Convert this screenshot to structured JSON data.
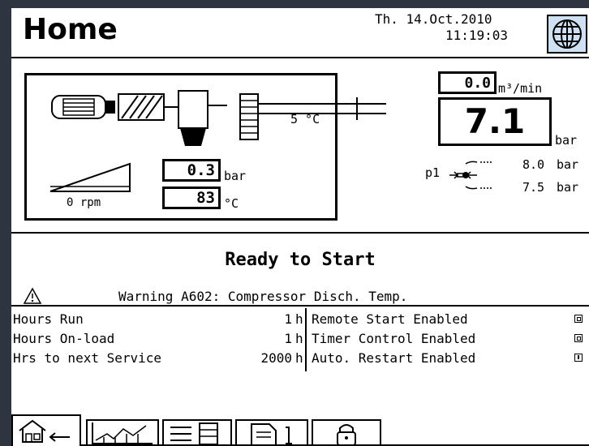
{
  "header": {
    "title": "Home",
    "date": "Th. 14.Oct.2010",
    "time": "11:19:03",
    "globe_icon": "globe-icon"
  },
  "machine": {
    "temp_label": "5 °C",
    "rpm_label": "0 rpm",
    "pressure_value": "0.3",
    "pressure_unit": "bar",
    "temp_value": "83",
    "temp_unit": "°C"
  },
  "flow": {
    "value": "0.0",
    "unit": "m³/min"
  },
  "pressure": {
    "value": "7.1",
    "unit": "bar",
    "p1_label": "p1",
    "upper_value": "8.0",
    "upper_unit": "bar",
    "lower_value": "7.5",
    "lower_unit": "bar"
  },
  "status": {
    "text": "Ready to Start",
    "warning_icon": "warning-triangle-icon",
    "warning_text": "Warning A602: Compressor Disch. Temp."
  },
  "counters": [
    {
      "label": "Hours Run",
      "value": "1",
      "unit": "h"
    },
    {
      "label": "Hours On-load",
      "value": "1",
      "unit": "h"
    },
    {
      "label": "Hrs to next Service",
      "value": "2000",
      "unit": "h"
    }
  ],
  "settings": [
    {
      "label": "Remote Start Enabled",
      "state": "on"
    },
    {
      "label": "Timer Control Enabled",
      "state": "on"
    },
    {
      "label": "Auto. Restart Enabled",
      "state": "off"
    }
  ],
  "tabs": [
    {
      "icon": "home-icon",
      "active": true
    },
    {
      "icon": "trend-chart-icon",
      "active": false
    },
    {
      "icon": "list-icon",
      "active": false
    },
    {
      "icon": "settings-doc-icon",
      "active": false
    },
    {
      "icon": "lock-icon",
      "active": false
    }
  ]
}
